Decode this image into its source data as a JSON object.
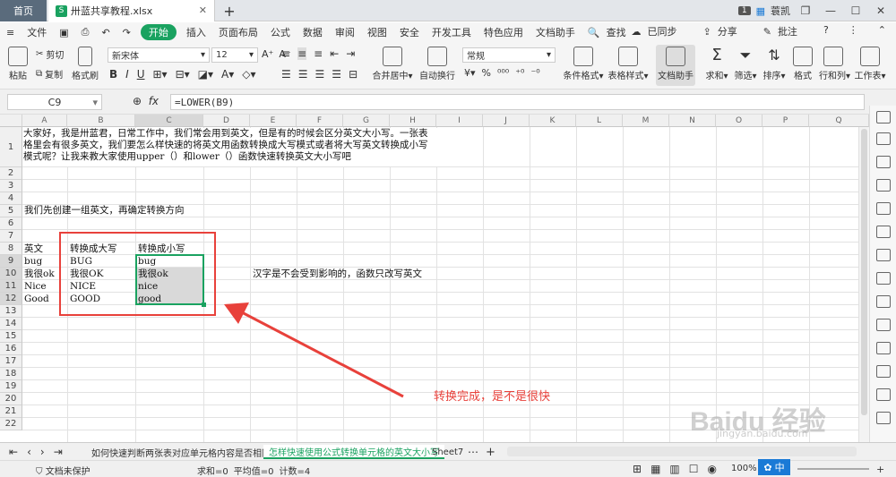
{
  "titlebar": {
    "home_tab": "首页",
    "doc_tab": "卅蓝共享教程.xlsx",
    "new_tab": "+",
    "page_badge": "1",
    "user_name": "蓑凯"
  },
  "menu": {
    "file": "文件",
    "start": "开始",
    "items": [
      "插入",
      "页面布局",
      "公式",
      "数据",
      "审阅",
      "视图",
      "安全",
      "开发工具",
      "特色应用",
      "文档助手"
    ],
    "search": "查找",
    "sync": "已同步",
    "share": "分享",
    "comment": "批注"
  },
  "ribbon": {
    "paste": "粘贴",
    "cut": "剪切",
    "copy": "复制",
    "format_painter": "格式刷",
    "font_name": "新宋体",
    "font_size": "12",
    "merge_center": "合并居中",
    "wrap_text": "自动换行",
    "number_format": "常规",
    "cond_format": "条件格式",
    "table_style": "表格样式",
    "doc_helper": "文档助手",
    "sum": "求和",
    "filter": "筛选",
    "sort": "排序",
    "format": "格式",
    "rowcol": "行和列",
    "worksheet": "工作表"
  },
  "formula_bar": {
    "cell_ref": "C9",
    "formula": "=LOWER(B9)"
  },
  "columns": [
    "A",
    "B",
    "C",
    "D",
    "E",
    "F",
    "G",
    "H",
    "I",
    "J",
    "K",
    "L",
    "M",
    "N",
    "O",
    "P",
    "Q"
  ],
  "rows": [
    "1",
    "2",
    "3",
    "4",
    "5",
    "6",
    "7",
    "8",
    "9",
    "10",
    "11",
    "12",
    "13",
    "14",
    "15",
    "16",
    "17",
    "18",
    "19",
    "20",
    "21",
    "22"
  ],
  "cells": {
    "intro_line1": "大家好，我是卅蓝君，日常工作中，我们常会用到英文，但是有的时候会区分英文大小写。一张表",
    "intro_line2": "格里会有很多英文，我们要怎么样快速的将英文用函数转换成大写模式或者将大写英文转换成小写",
    "intro_line3": "模式呢？让我来教大家使用upper（）和lower（）函数快速转换英文大小写吧",
    "a5": "我们先创建一组英文，再确定转换方向",
    "a8": "英文",
    "b8": "转换成大写",
    "c8": "转换成小写",
    "a9": "bug",
    "b9": "BUG",
    "c9": "bug",
    "a10": "我很ok",
    "b10": "我很OK",
    "c10": "我很ok",
    "a11": "Nice",
    "b11": "NICE",
    "c11": "nice",
    "a12": "Good",
    "b12": "GOOD",
    "c12": "good",
    "f10": "汉字是不会受到影响的，函数只改写英文"
  },
  "annotation": {
    "text": "转换完成，是不是很快",
    "color": "#e8413b"
  },
  "sheet_tabs": {
    "tab1": "如何快速判断两张表对应单元格内容是否相同",
    "tab2": "怎样快速使用公式转换单元格的英文大小写",
    "tab3": "Sheet7"
  },
  "status": {
    "doc_protect": "文档未保护",
    "sum": "求和=0",
    "avg": "平均值=0",
    "count": "计数=4",
    "zoom": "100%",
    "ime": "中"
  },
  "watermark": "Baidu 经验",
  "watermark_url": "jingyan.baidu.com",
  "colors": {
    "green": "#1aa260",
    "red": "#e8413b",
    "selection": "#d9d9d9"
  }
}
